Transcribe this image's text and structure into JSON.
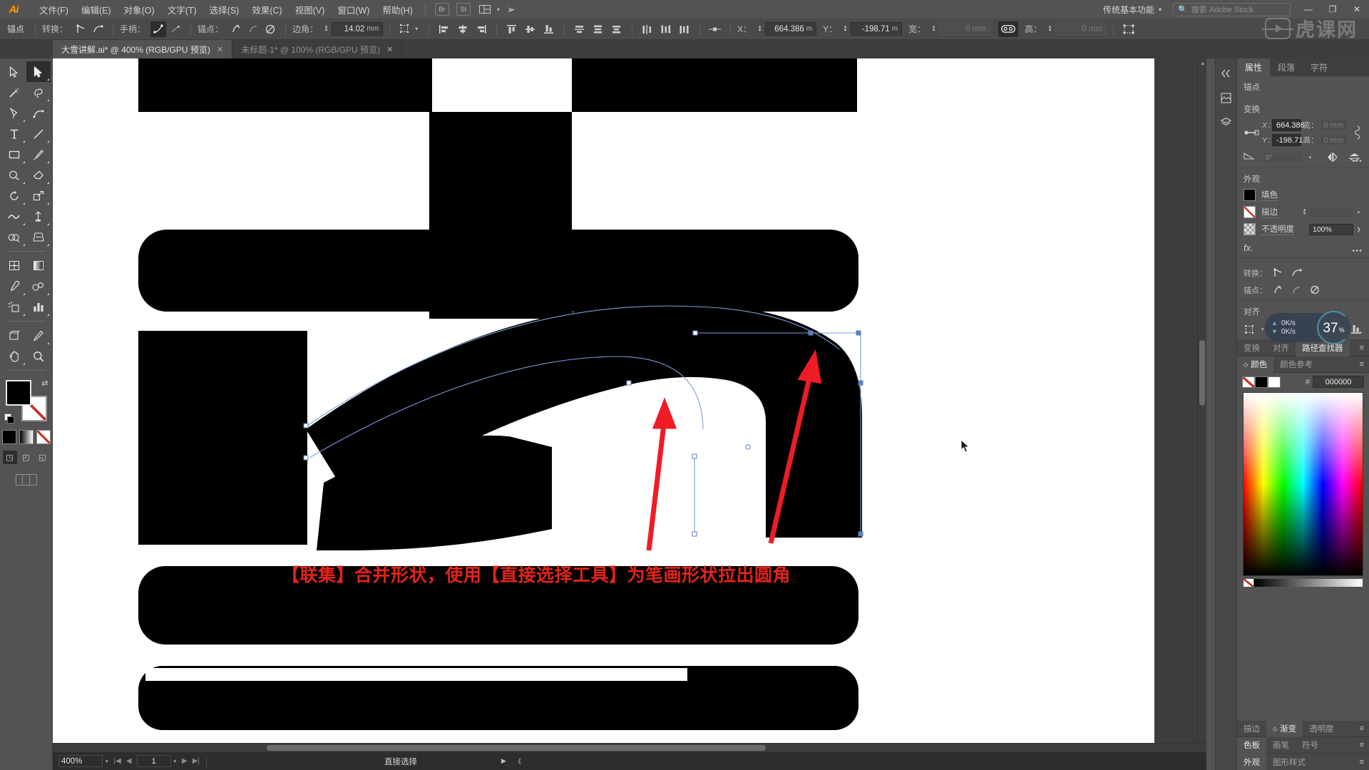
{
  "app": {
    "name": "Adobe Illustrator",
    "logo_text": "Ai"
  },
  "menubar": {
    "items": [
      {
        "label": "文件(F)"
      },
      {
        "label": "编辑(E)"
      },
      {
        "label": "对象(O)"
      },
      {
        "label": "文字(T)"
      },
      {
        "label": "选择(S)"
      },
      {
        "label": "效果(C)"
      },
      {
        "label": "视图(V)"
      },
      {
        "label": "窗口(W)"
      },
      {
        "label": "帮助(H)"
      }
    ],
    "icon_br": "Br",
    "icon_st": "St",
    "workspace": "传统基本功能",
    "search_placeholder": "搜索 Adobe Stock",
    "minimize": "—",
    "restore": "❐",
    "close": "✕"
  },
  "watermark": {
    "text": "虎课网"
  },
  "controlbar": {
    "anchor_label": "锚点",
    "convert_label": "转换：",
    "handle_label": "手柄：",
    "anchor2_label": "锚点：",
    "corner_label": "边角：",
    "corner_value": "14.02",
    "corner_unit": "mm",
    "x_label": "X：",
    "x_value": "664.386",
    "x_unit": "m",
    "y_label": "Y：",
    "y_value": "-198.71",
    "y_unit": "m",
    "w_label": "宽：",
    "w_value": "0 mm",
    "h_label": "高：",
    "h_value": "0 mm"
  },
  "tabs": [
    {
      "label": "大雪讲解.ai* @ 400% (RGB/GPU 预览)",
      "active": true,
      "close": "✕"
    },
    {
      "label": "未标题-1* @ 100% (RGB/GPU 预览)",
      "active": false,
      "close": "✕"
    }
  ],
  "canvas": {
    "annotation": "【联集】合并形状，使用【直接选择工具】为笔画形状拉出圆角",
    "annotation_color": "#e2231a",
    "artwork_color": "#000000",
    "arrow_color": "#ee1c25",
    "path_color": "#7b9fd4"
  },
  "statusbar": {
    "zoom": "400%",
    "page": "1",
    "first": "|◀",
    "prev": "◀",
    "next": "▶",
    "last": "▶|",
    "tool": "直接选择",
    "play": "▶",
    "extra": "《"
  },
  "properties": {
    "tabs": [
      {
        "label": "属性",
        "active": true
      },
      {
        "label": "段落",
        "active": false
      },
      {
        "label": "字符",
        "active": false
      }
    ],
    "object_type": "锚点",
    "transform": {
      "title": "变换",
      "x_label": "X：",
      "x_value": "664.386",
      "y_label": "Y：",
      "y_value": "-198.71",
      "w_label": "宽：",
      "w_value": "0 mm",
      "h_label": "高：",
      "h_value": "0 mm",
      "angle_label": "∠：",
      "angle_value": "0°"
    },
    "appearance": {
      "title": "外观",
      "fill_label": "填色",
      "fill_color": "#000000",
      "stroke_label": "描边",
      "stroke_value": "",
      "opacity_label": "不透明度",
      "opacity_value": "100%",
      "fx_label": "fx."
    },
    "quick_actions": {
      "convert_label": "转换：",
      "anchor_label": "锚点：",
      "align_label": "对齐"
    }
  },
  "dock_panels": {
    "group1": [
      {
        "label": "变换",
        "active": false
      },
      {
        "label": "对齐",
        "active": false
      },
      {
        "label": "路径查找器",
        "active": true
      }
    ],
    "group2": [
      {
        "label": "颜色",
        "active": true
      },
      {
        "label": "颜色参考",
        "active": false
      }
    ],
    "group3": [
      {
        "label": "描边",
        "active": false
      },
      {
        "label": "渐变",
        "active": true
      },
      {
        "label": "透明度",
        "active": false
      }
    ],
    "group4": [
      {
        "label": "色板",
        "active": true
      },
      {
        "label": "画笔",
        "active": false
      },
      {
        "label": "符号",
        "active": false
      }
    ],
    "group5": [
      {
        "label": "外观",
        "active": true
      },
      {
        "label": "图形样式",
        "active": false
      }
    ],
    "menu_glyph": "≡"
  },
  "color_panel": {
    "hex_label": "#",
    "hex_value": "000000"
  },
  "net_widget": {
    "upload": "0K/s",
    "download": "0K/s",
    "battery": "37",
    "battery_unit": "%"
  }
}
